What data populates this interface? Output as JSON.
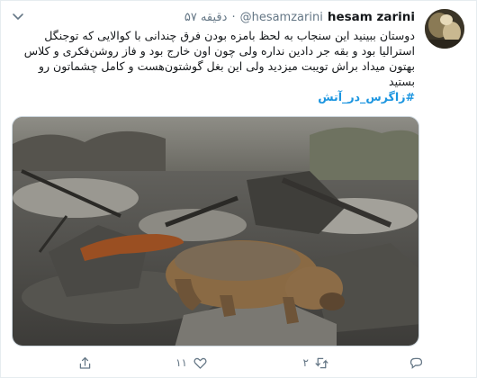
{
  "tweet": {
    "author_name": "hesam zarini",
    "handle": "@hesamzarini",
    "separator": "·",
    "time": "۵۷ دقیقه",
    "text": "دوستان ببینید این سنجاب به لحظ بامزه بودن فرق چندانی با کوالایی که توجنگل استرالیا بود و بقه جر دادین نداره ولی چون اون خارج بود و فاز روشن‌فکری و کلاس بهتون میداد براش تویبت میزدید ولی این بغل گوشتون‌هست و کامل چشماتون رو بستید",
    "hashtag": "#زاگرس_در_آتش"
  },
  "actions": {
    "reply_icon": "reply-icon",
    "retweet_icon": "retweet-icon",
    "retweet_count": "۲",
    "like_icon": "heart-icon",
    "like_count": "۱۱",
    "share_icon": "share-icon"
  },
  "colors": {
    "link": "#1b95e0",
    "muted": "#657786",
    "border": "#e6ecf0"
  }
}
